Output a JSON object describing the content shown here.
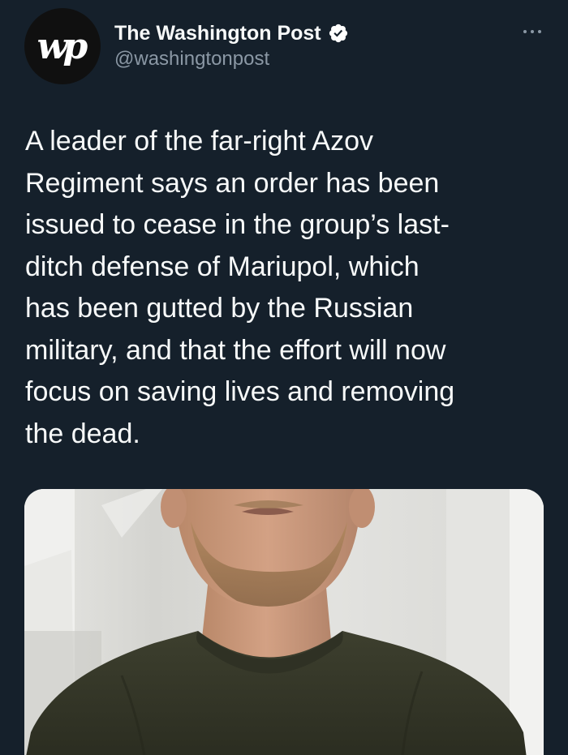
{
  "tweet": {
    "author": {
      "display_name": "The Washington Post",
      "handle": "@washingtonpost",
      "avatar_text": "wp",
      "avatar_icon": "washington-post-logo",
      "verified_icon": "verified-badge-icon"
    },
    "more_icon": "more-options-icon",
    "text": "A leader of the far-right Azov\nRegiment says an order has been\nissued to cease in the group’s last-\nditch defense of Mariupol, which\nhas been gutted by the Russian\nmilitary, and that the effort will now\nfocus on saving lives and removing\nthe dead."
  },
  "colors": {
    "background": "#15202b",
    "primary_text": "#f7f9f9",
    "secondary_text": "#8b98a5",
    "verified_badge": "#ffffff"
  }
}
